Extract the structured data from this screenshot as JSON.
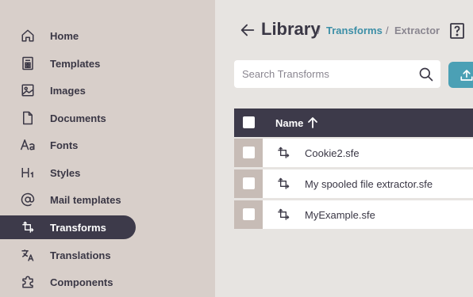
{
  "sidebar": {
    "items": [
      {
        "label": "Home",
        "icon": "home-icon"
      },
      {
        "label": "Templates",
        "icon": "templates-icon"
      },
      {
        "label": "Images",
        "icon": "image-icon"
      },
      {
        "label": "Documents",
        "icon": "document-icon"
      },
      {
        "label": "Fonts",
        "icon": "fonts-icon"
      },
      {
        "label": "Styles",
        "icon": "heading-icon"
      },
      {
        "label": "Mail templates",
        "icon": "at-icon"
      },
      {
        "label": "Transforms",
        "icon": "transform-icon",
        "active": true
      },
      {
        "label": "Translations",
        "icon": "translate-icon"
      },
      {
        "label": "Components",
        "icon": "puzzle-icon"
      }
    ]
  },
  "header": {
    "title": "Library",
    "separator": "/",
    "breadcrumb_link": "Transforms",
    "breadcrumb_current": "Extractor"
  },
  "search": {
    "placeholder": "Search Transforms",
    "value": ""
  },
  "table": {
    "column_name": "Name",
    "rows": [
      {
        "name": "Cookie2.sfe"
      },
      {
        "name": "My spooled file extractor.sfe"
      },
      {
        "name": "MyExample.sfe"
      }
    ]
  },
  "colors": {
    "sidebar_bg": "#d8cfca",
    "main_bg": "#e7e4e1",
    "dark": "#3d3a4a",
    "accent": "#4ba0b5",
    "link": "#3d8fa7"
  }
}
